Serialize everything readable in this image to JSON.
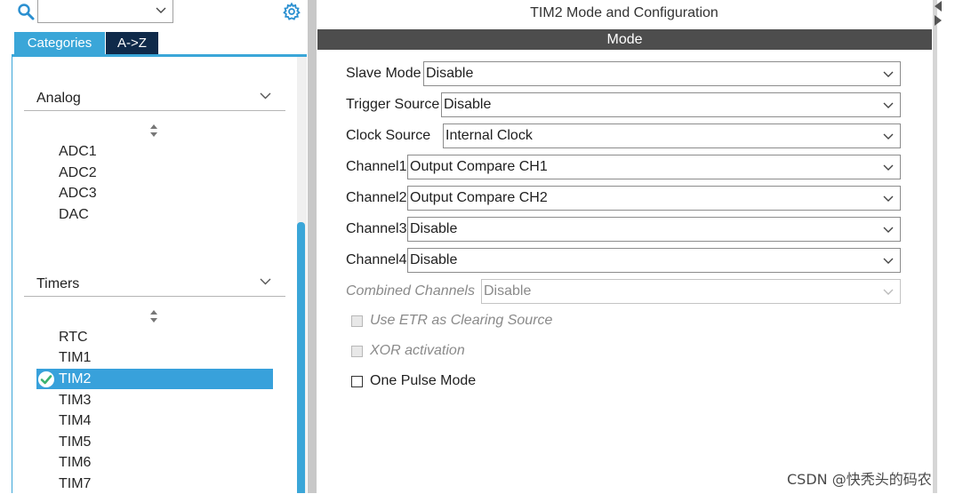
{
  "sidebar": {
    "tabs": [
      {
        "label": "Categories",
        "active": true
      },
      {
        "label": "A->Z",
        "active": false
      }
    ],
    "sections": [
      {
        "title": "Analog",
        "items": [
          "ADC1",
          "ADC2",
          "ADC3",
          "DAC"
        ]
      },
      {
        "title": "Timers",
        "items": [
          "RTC",
          "TIM1",
          "TIM2",
          "TIM3",
          "TIM4",
          "TIM5",
          "TIM6",
          "TIM7"
        ],
        "selected": "TIM2"
      }
    ]
  },
  "config": {
    "title": "TIM2 Mode and Configuration",
    "section_bar": "Mode",
    "fields": [
      {
        "label": "Slave Mode",
        "value": "Disable"
      },
      {
        "label": "Trigger Source",
        "value": "Disable"
      },
      {
        "label": "Clock Source",
        "value": "Internal Clock"
      },
      {
        "label": "Channel1",
        "value": "Output Compare CH1"
      },
      {
        "label": "Channel2",
        "value": "Output Compare CH2"
      },
      {
        "label": "Channel3",
        "value": "Disable"
      },
      {
        "label": "Channel4",
        "value": "Disable"
      },
      {
        "label": "Combined Channels",
        "value": "Disable",
        "disabled": true
      }
    ],
    "checkboxes": [
      {
        "label": "Use ETR as Clearing Source",
        "checked": false,
        "disabled": true
      },
      {
        "label": "XOR activation",
        "checked": false,
        "disabled": true
      },
      {
        "label": "One Pulse Mode",
        "checked": false,
        "disabled": false
      }
    ]
  },
  "watermark": "CSDN @快秃头的码农",
  "colors": {
    "accent": "#3aa6d8",
    "tab_dark": "#0f2a4a",
    "mode_bar": "#4d4d4d",
    "selected_row": "#38a1db",
    "check_green": "#3cb371"
  }
}
